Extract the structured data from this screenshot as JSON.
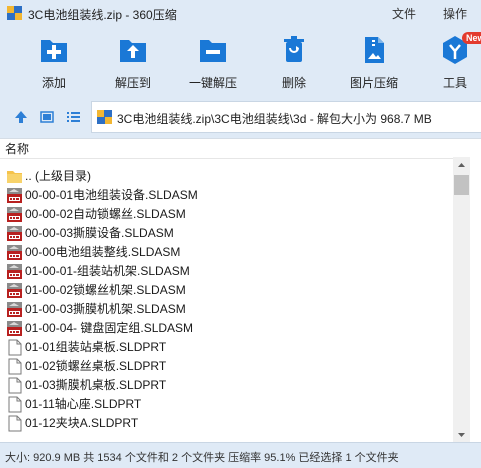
{
  "window": {
    "title": "3C电池组装线.zip - 360压缩",
    "menu": [
      "文件",
      "操作"
    ]
  },
  "toolbar": {
    "tools": [
      {
        "label": "添加",
        "icon": "add-icon"
      },
      {
        "label": "解压到",
        "icon": "extract-to-icon"
      },
      {
        "label": "一键解压",
        "icon": "one-click-extract-icon"
      },
      {
        "label": "删除",
        "icon": "delete-icon"
      },
      {
        "label": "图片压缩",
        "icon": "image-compress-icon"
      },
      {
        "label": "工具",
        "icon": "tools-icon",
        "badge": "New"
      }
    ],
    "colors": {
      "icon_blue": "#1a78d6",
      "badge_red": "#e33b2e"
    }
  },
  "address": {
    "path": "3C电池组装线.zip\\3C电池组装线\\3d - 解包大小为 968.7 MB"
  },
  "list": {
    "column_name": "名称",
    "items": [
      {
        "name": ".. (上级目录)",
        "type": "folder"
      },
      {
        "name": "00-00-01电池组装设备.SLDASM",
        "type": "sldasm"
      },
      {
        "name": "00-00-02自动锁螺丝.SLDASM",
        "type": "sldasm"
      },
      {
        "name": "00-00-03撕膜设备.SLDASM",
        "type": "sldasm"
      },
      {
        "name": "00-00电池组装整线.SLDASM",
        "type": "sldasm"
      },
      {
        "name": "01-00-01-组装站机架.SLDASM",
        "type": "sldasm"
      },
      {
        "name": "01-00-02锁螺丝机架.SLDASM",
        "type": "sldasm"
      },
      {
        "name": "01-00-03撕膜机机架.SLDASM",
        "type": "sldasm"
      },
      {
        "name": "01-00-04- 键盘固定组.SLDASM",
        "type": "sldasm"
      },
      {
        "name": "01-01组装站桌板.SLDPRT",
        "type": "sldprt"
      },
      {
        "name": "01-02锁螺丝桌板.SLDPRT",
        "type": "sldprt"
      },
      {
        "name": "01-03撕膜机桌板.SLDPRT",
        "type": "sldprt"
      },
      {
        "name": "01-11轴心座.SLDPRT",
        "type": "sldprt"
      },
      {
        "name": "01-12夹块A.SLDPRT",
        "type": "sldprt"
      }
    ]
  },
  "status": {
    "text": "大小: 920.9 MB 共 1534 个文件和 2 个文件夹 压缩率 95.1% 已经选择 1 个文件夹"
  }
}
